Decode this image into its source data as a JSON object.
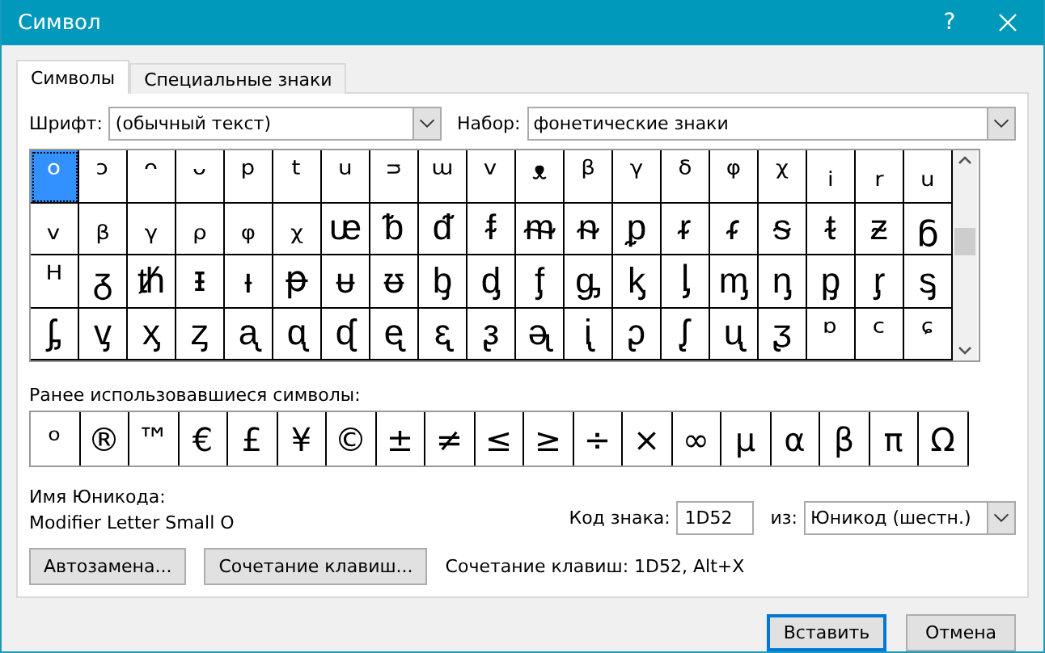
{
  "window": {
    "title": "Символ",
    "help": "?"
  },
  "tabs": [
    {
      "label": "Символы",
      "selected": true
    },
    {
      "label": "Специальные знаки",
      "selected": false
    }
  ],
  "font": {
    "label": "Шрифт:",
    "value": "(обычный текст)"
  },
  "subset": {
    "label": "Набор:",
    "value": "фонетические знаки"
  },
  "symbols": [
    [
      {
        "char": "ᵒ",
        "selected": true
      },
      {
        "char": "ᵓ",
        "selected": false
      },
      {
        "char": "ᵔ",
        "selected": false
      },
      {
        "char": "ᵕ",
        "selected": false
      },
      {
        "char": "ᵖ",
        "selected": false
      },
      {
        "char": "ᵗ",
        "selected": false
      },
      {
        "char": "ᵘ",
        "selected": false
      },
      {
        "char": "ᵙ",
        "selected": false
      },
      {
        "char": "ᵚ",
        "selected": false
      },
      {
        "char": "ᵛ",
        "selected": false
      },
      {
        "char": "ᵜ",
        "selected": false
      },
      {
        "char": "ᵝ",
        "selected": false
      },
      {
        "char": "ᵞ",
        "selected": false
      },
      {
        "char": "ᵟ",
        "selected": false
      },
      {
        "char": "ᵠ",
        "selected": false
      },
      {
        "char": "ᵡ",
        "selected": false
      },
      {
        "char": "ᵢ",
        "selected": false
      },
      {
        "char": "ᵣ",
        "selected": false
      },
      {
        "char": "ᵤ",
        "selected": false
      }
    ],
    [
      {
        "char": "ᵥ",
        "selected": false
      },
      {
        "char": "ᵦ",
        "selected": false
      },
      {
        "char": "ᵧ",
        "selected": false
      },
      {
        "char": "ᵨ",
        "selected": false
      },
      {
        "char": "ᵩ",
        "selected": false
      },
      {
        "char": "ᵪ",
        "selected": false
      },
      {
        "char": "ᵫ",
        "selected": false
      },
      {
        "char": "ᵬ",
        "selected": false
      },
      {
        "char": "ᵭ",
        "selected": false
      },
      {
        "char": "ᵮ",
        "selected": false
      },
      {
        "char": "ᵯ",
        "selected": false
      },
      {
        "char": "ᵰ",
        "selected": false
      },
      {
        "char": "ᵱ",
        "selected": false
      },
      {
        "char": "ᵲ",
        "selected": false
      },
      {
        "char": "ᵳ",
        "selected": false
      },
      {
        "char": "ᵴ",
        "selected": false
      },
      {
        "char": "ᵵ",
        "selected": false
      },
      {
        "char": "ᵶ",
        "selected": false
      },
      {
        "char": "ᵷ",
        "selected": false
      }
    ],
    [
      {
        "char": "ᵸ",
        "selected": false
      },
      {
        "char": "ᵹ",
        "selected": false
      },
      {
        "char": "ᵺ",
        "selected": false
      },
      {
        "char": "ᵻ",
        "selected": false
      },
      {
        "char": "ᵼ",
        "selected": false
      },
      {
        "char": "ᵽ",
        "selected": false
      },
      {
        "char": "ᵾ",
        "selected": false
      },
      {
        "char": "ᵿ",
        "selected": false
      },
      {
        "char": "ᶀ",
        "selected": false
      },
      {
        "char": "ᶁ",
        "selected": false
      },
      {
        "char": "ᶂ",
        "selected": false
      },
      {
        "char": "ᶃ",
        "selected": false
      },
      {
        "char": "ᶄ",
        "selected": false
      },
      {
        "char": "ᶅ",
        "selected": false
      },
      {
        "char": "ᶆ",
        "selected": false
      },
      {
        "char": "ᶇ",
        "selected": false
      },
      {
        "char": "ᶈ",
        "selected": false
      },
      {
        "char": "ᶉ",
        "selected": false
      },
      {
        "char": "ᶊ",
        "selected": false
      }
    ],
    [
      {
        "char": "ᶋ",
        "selected": false
      },
      {
        "char": "ᶌ",
        "selected": false
      },
      {
        "char": "ᶍ",
        "selected": false
      },
      {
        "char": "ᶎ",
        "selected": false
      },
      {
        "char": "ᶏ",
        "selected": false
      },
      {
        "char": "ᶐ",
        "selected": false
      },
      {
        "char": "ᶑ",
        "selected": false
      },
      {
        "char": "ᶒ",
        "selected": false
      },
      {
        "char": "ᶓ",
        "selected": false
      },
      {
        "char": "ᶔ",
        "selected": false
      },
      {
        "char": "ᶕ",
        "selected": false
      },
      {
        "char": "ᶖ",
        "selected": false
      },
      {
        "char": "ᶗ",
        "selected": false
      },
      {
        "char": "ᶘ",
        "selected": false
      },
      {
        "char": "ᶙ",
        "selected": false
      },
      {
        "char": "ᶚ",
        "selected": false
      },
      {
        "char": "ᶛ",
        "selected": false
      },
      {
        "char": "ᶜ",
        "selected": false
      },
      {
        "char": "ᶝ",
        "selected": false
      }
    ]
  ],
  "recent": {
    "label": "Ранее использовавшиеся символы:",
    "symbols": [
      "ᵒ",
      "®",
      "™",
      "€",
      "£",
      "¥",
      "©",
      "±",
      "≠",
      "≤",
      "≥",
      "÷",
      "×",
      "∞",
      "μ",
      "α",
      "β",
      "π",
      "Ω"
    ]
  },
  "unicode_name": {
    "label": "Имя Юникода:",
    "value": "Modifier Letter Small O"
  },
  "char_code": {
    "label": "Код знака:",
    "value": "1D52"
  },
  "from": {
    "label": "из:",
    "value": "Юникод (шестн.)"
  },
  "autocorrect_button": "Автозамена...",
  "shortcut_button": "Сочетание клавиш...",
  "shortcut_text": "Сочетание клавиш: 1D52, Alt+X",
  "footer_buttons": [
    {
      "label": "Вставить",
      "default": true
    },
    {
      "label": "Отмена",
      "default": false
    }
  ]
}
